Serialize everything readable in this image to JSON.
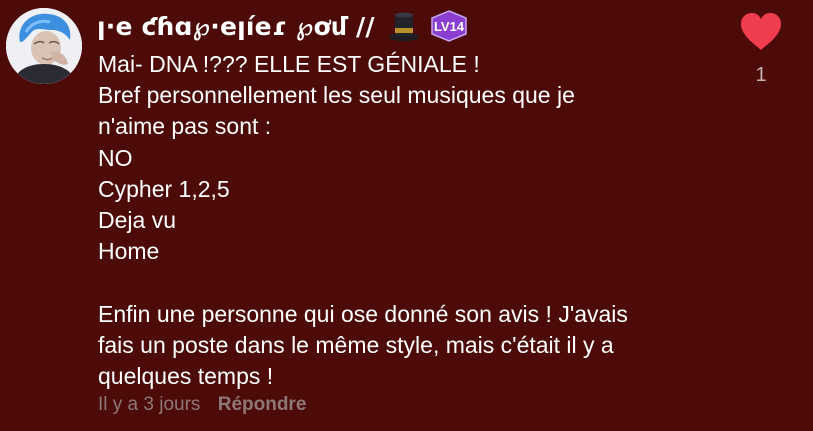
{
  "comment": {
    "author": {
      "username": "ꞁ·e ƈɦɑ℘·eꞁíeɾ ℘ơմ //",
      "badge_icon": "top-hat-icon",
      "level_badge": "LV14",
      "level_color": "#8a3fd1"
    },
    "body": [
      "Mai- DNA !??? ELLE EST GÉNIALE !",
      "Bref personnellement les seul musiques que je",
      "n'aime pas sont :",
      "NO",
      "Cypher 1,2,5",
      "Deja vu",
      "Home",
      "",
      "Enfin une personne qui ose donné son avis ! J'avais",
      "fais un poste dans le même style, mais c'était il y a",
      "quelques temps !"
    ],
    "timestamp": "Il y a 3 jours",
    "reply_label": "Répondre",
    "likes": {
      "count": "1",
      "icon": "heart-icon",
      "color": "#ef3d4f"
    }
  },
  "colors": {
    "background": "#4c0b09",
    "text": "#ffffff",
    "meta_text": "#8f7776"
  }
}
